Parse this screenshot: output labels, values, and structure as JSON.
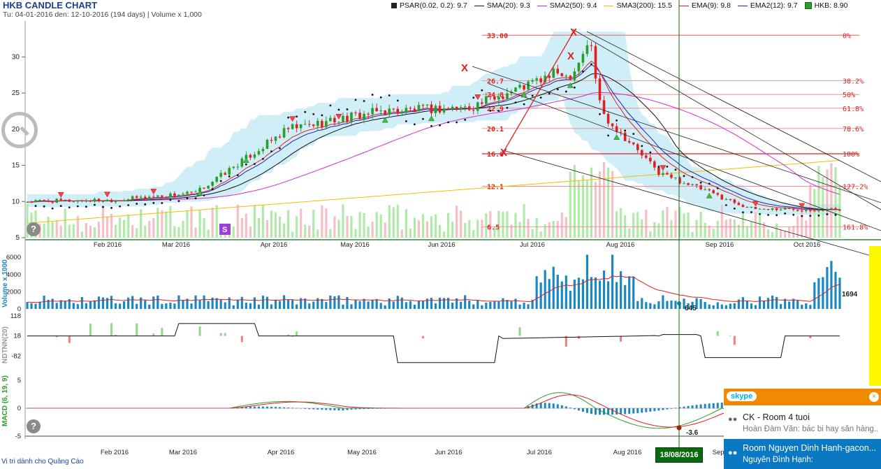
{
  "header": {
    "title": "HKB CANDLE CHART",
    "subtitle": "Tu: 04-01-2016 den: 12-10-2016 (194 days) | Volume x 1,000"
  },
  "legend": [
    {
      "label": "PSAR(0.02, 0.2): 9.7",
      "color": "#222222",
      "kind": "square"
    },
    {
      "label": "SMA(20): 9.3",
      "color": "#111111",
      "kind": "line"
    },
    {
      "label": "SMA2(50): 9.4",
      "color": "#d42ad4",
      "kind": "line"
    },
    {
      "label": "SMA3(200): 15.5",
      "color": "#f0c000",
      "kind": "line"
    },
    {
      "label": "EMA(9): 9.8",
      "color": "#e02020",
      "kind": "line"
    },
    {
      "label": "EMA2(12): 9.7",
      "color": "#2020c0",
      "kind": "line"
    },
    {
      "label": "HKB: 8.90",
      "color": "#2a9d2a",
      "kind": "greensquare"
    }
  ],
  "chart_data": [
    {
      "type": "candlestick",
      "title": "HKB CANDLE CHART",
      "x_labels": [
        "Feb 2016",
        "Mar 2016",
        "Apr 2016",
        "May 2016",
        "Jun 2016",
        "Jul 2016",
        "Aug 2016",
        "Sep 2016",
        "Oct 2016"
      ],
      "y_ticks": [
        5,
        10,
        15,
        20,
        25,
        30
      ],
      "ylim": [
        5,
        34
      ],
      "close_by_month": [
        {
          "month": "Jan 2016",
          "close": 10.0
        },
        {
          "month": "Feb 2016",
          "close": 10.2
        },
        {
          "month": "Mar 2016",
          "close": 11.2
        },
        {
          "month": "Apr 2016",
          "close": 20.0
        },
        {
          "month": "May 2016",
          "close": 22.5
        },
        {
          "month": "Jun 2016",
          "close": 23.0
        },
        {
          "month": "Jul 2016",
          "close": 28.0
        },
        {
          "month": "Aug 2016",
          "close": 14.0
        },
        {
          "month": "Sep 2016",
          "close": 9.0
        },
        {
          "month": "Oct 2016",
          "close": 8.9
        }
      ],
      "fibonacci": [
        {
          "price": "33.00",
          "level": "0%"
        },
        {
          "price": "26.7",
          "level": "38.2%"
        },
        {
          "price": "24.8",
          "level": "50%"
        },
        {
          "price": "22.9",
          "level": "61.8%"
        },
        {
          "price": "20.1",
          "level": "78.6%"
        },
        {
          "price": "16.6",
          "level": "100%"
        },
        {
          "price": "12.1",
          "level": "127.2%"
        },
        {
          "price": "6.5",
          "level": "161.8%"
        }
      ],
      "marker_s": "S"
    },
    {
      "type": "bar",
      "ylabel": "Volume x 1000",
      "y_ticks": [
        0,
        2000,
        4000,
        6000
      ],
      "ylim": [
        0,
        6500
      ],
      "last_value": "1694",
      "cursor_value": "645"
    },
    {
      "type": "line",
      "ylabel": "NDTNN(20)",
      "y_ticks": [
        -82,
        18,
        118
      ],
      "ylim": [
        -182,
        118
      ]
    },
    {
      "type": "line",
      "ylabel": "MACD (6, 19, 9)",
      "y_ticks": [
        -5,
        0,
        5
      ],
      "ylim": [
        -5,
        5.5
      ],
      "cursor_value": "-3.6",
      "x_labels": [
        "Feb 2016",
        "Mar 2016",
        "Apr 2016",
        "May 2016",
        "Jun 2016",
        "Jul 2016",
        "Aug 2016",
        "Sep 2016",
        "Oct 2016"
      ]
    }
  ],
  "cursor_date": "18/08/2016",
  "ad_note": "Vi tri dành cho Quảng Cáo",
  "help_glyph": "?",
  "skype": {
    "brand": "skype",
    "close_glyph": "×",
    "contacts": [
      {
        "title": "CK - Room 4 tuoi",
        "message": "Hoàn Đàm Văn: bác bi hay săn hàng..."
      },
      {
        "title": "Room Nguyen Dinh Hanh-gacon...",
        "message": "Nguyễn Đình Hạnh:"
      }
    ]
  },
  "colors": {
    "up": "#2a9d2a",
    "down": "#e02020",
    "band": "#c8ebf7",
    "vol_bar": "#1a88c2",
    "accent_green": "#0b6a10"
  }
}
